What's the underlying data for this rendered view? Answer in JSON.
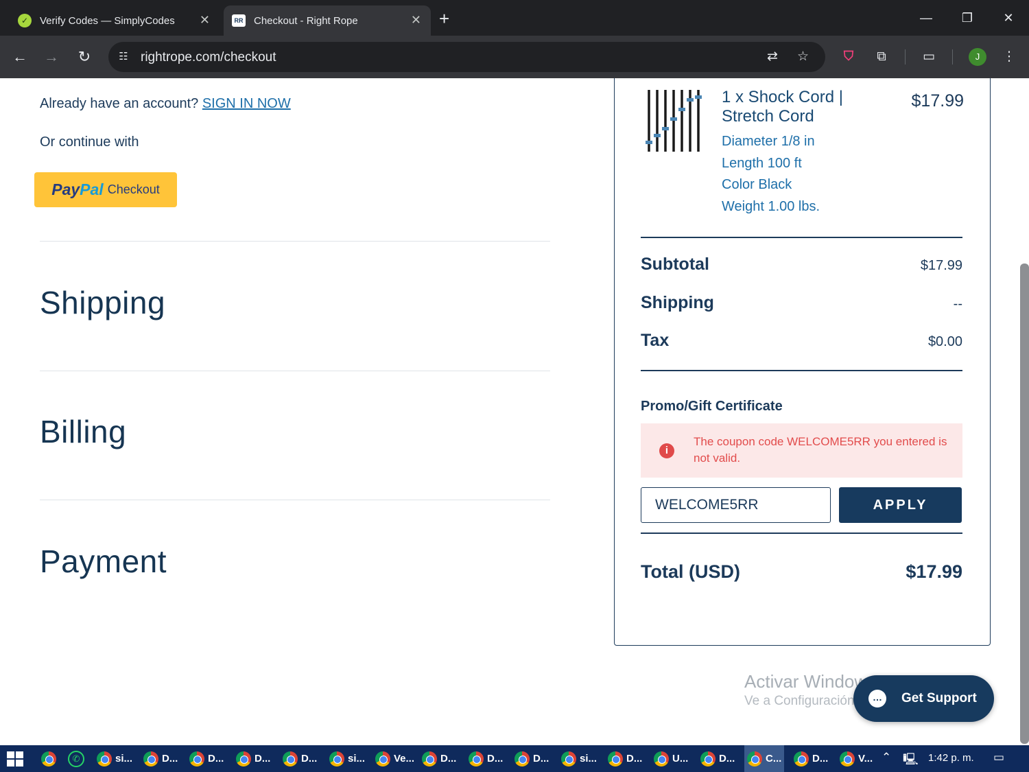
{
  "browser": {
    "tabs": [
      {
        "title": "Verify Codes — SimplyCodes",
        "active": false,
        "favicon": "simplycodes-icon"
      },
      {
        "title": "Checkout - Right Rope",
        "active": true,
        "favicon": "rightrope-icon"
      }
    ],
    "url": "rightrope.com/checkout",
    "profile_initial": "J"
  },
  "left": {
    "account_prompt": "Already have an account?",
    "sign_in_link": "SIGN IN NOW",
    "continue_with": "Or continue with",
    "paypal": {
      "pay": "Pay",
      "pal": "Pal",
      "label": "Checkout"
    },
    "sections": [
      "Shipping",
      "Billing",
      "Payment"
    ]
  },
  "summary": {
    "item": {
      "name": "1 x Shock Cord | Stretch Cord",
      "price": "$17.99",
      "attributes": [
        "Diameter 1/8 in",
        "Length 100 ft",
        "Color Black",
        "Weight 1.00 lbs."
      ]
    },
    "rows": [
      {
        "label": "Subtotal",
        "value": "$17.99"
      },
      {
        "label": "Shipping",
        "value": "--"
      },
      {
        "label": "Tax",
        "value": "$0.00"
      }
    ],
    "promo": {
      "title": "Promo/Gift Certificate",
      "error": "The coupon code WELCOME5RR you entered is not valid.",
      "code_value": "WELCOME5RR",
      "apply_label": "APPLY"
    },
    "total": {
      "label": "Total (USD)",
      "value": "$17.99"
    }
  },
  "watermark": {
    "line1": "Activar Windows",
    "line2": "Ve a Configuración para activar Windows."
  },
  "support_label": "Get Support",
  "taskbar": {
    "items": [
      "si...",
      "D...",
      "D...",
      "D...",
      "D...",
      "si...",
      "Ve...",
      "D...",
      "D...",
      "D...",
      "si...",
      "D...",
      "U...",
      "D...",
      "C...",
      "D...",
      "V..."
    ],
    "active_index": 14,
    "clock": "1:42 p. m."
  },
  "colors": {
    "brand_navy": "#173a5e",
    "link_blue": "#1e6fa9",
    "error_red": "#e24c4c",
    "paypal_yellow": "#ffc439"
  }
}
